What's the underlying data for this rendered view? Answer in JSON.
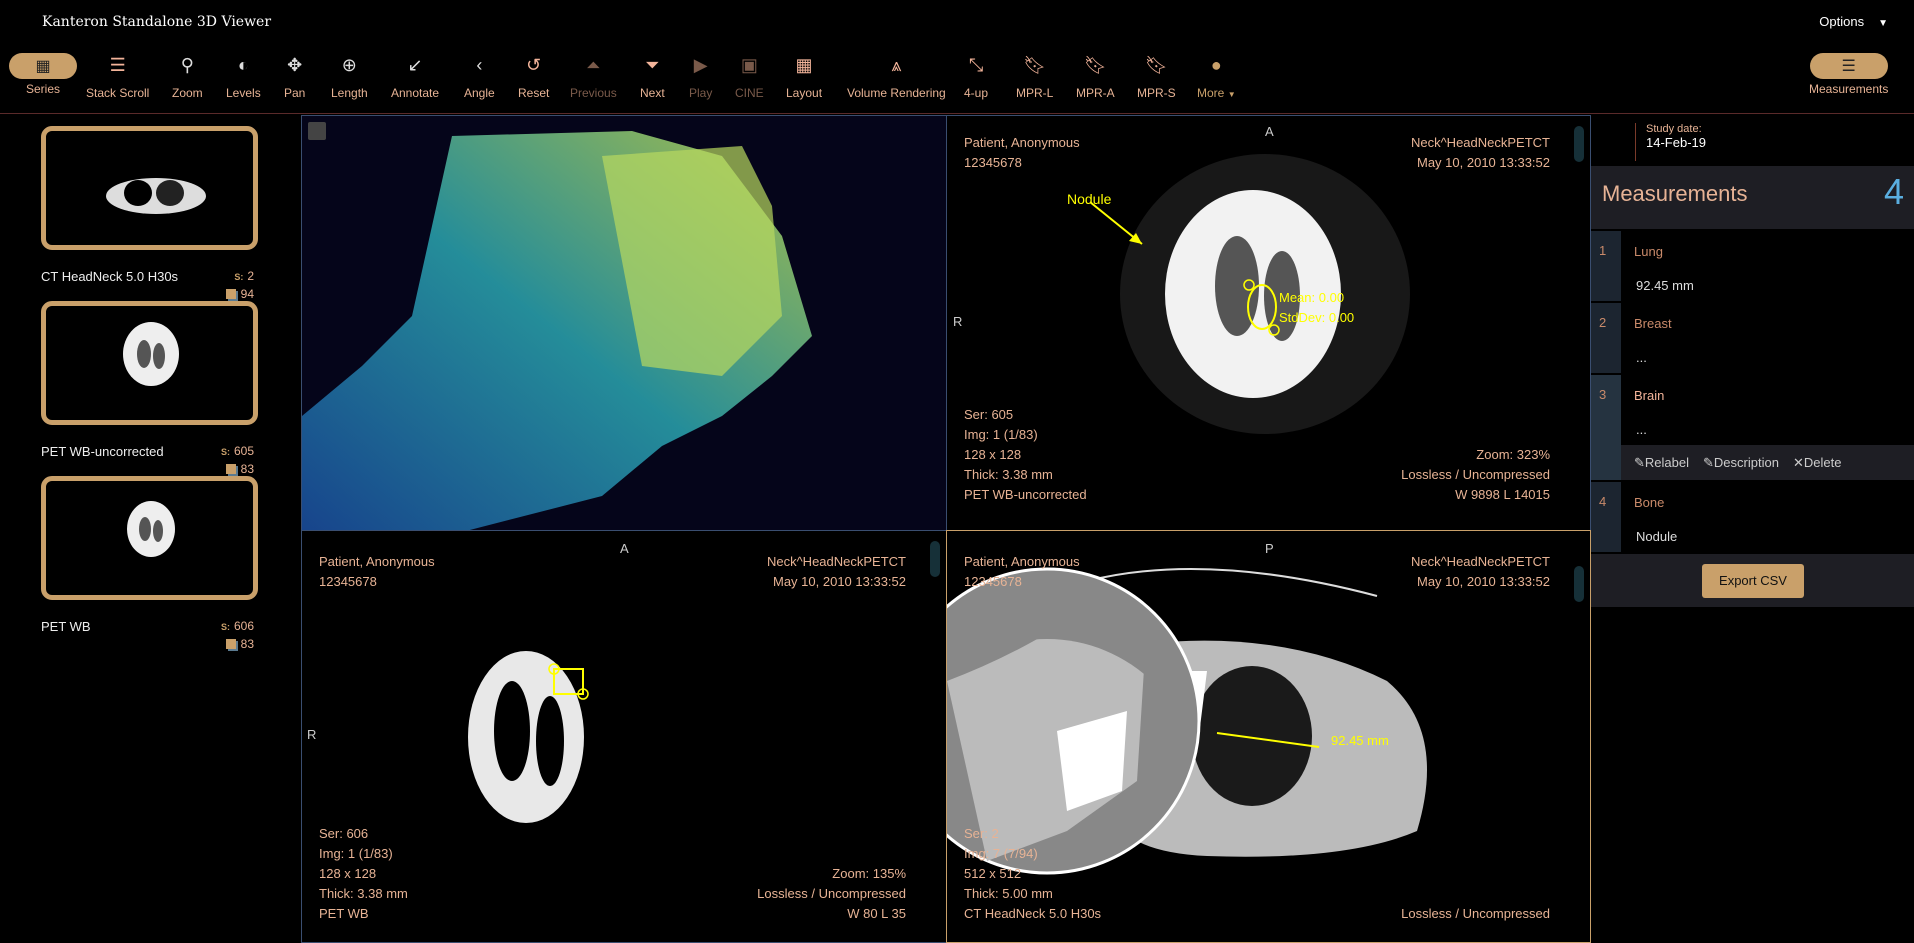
{
  "app": {
    "title": "Kanteron Standalone 3D Viewer",
    "options_label": "Options"
  },
  "toolbar": [
    {
      "label": "Series",
      "icon": "grid-icon"
    },
    {
      "label": "Stack Scroll",
      "icon": "bars-icon"
    },
    {
      "label": "Zoom",
      "icon": "search-icon"
    },
    {
      "label": "Levels",
      "icon": "contrast-icon"
    },
    {
      "label": "Pan",
      "icon": "move-icon"
    },
    {
      "label": "Length",
      "icon": "ruler-icon"
    },
    {
      "label": "Annotate",
      "icon": "arrow-icon"
    },
    {
      "label": "Angle",
      "icon": "angle-icon"
    },
    {
      "label": "Reset",
      "icon": "undo-icon"
    },
    {
      "label": "Previous",
      "icon": "previous-icon"
    },
    {
      "label": "Next",
      "icon": "next-icon"
    },
    {
      "label": "Play",
      "icon": "play-icon"
    },
    {
      "label": "CINE",
      "icon": "youtube-icon"
    },
    {
      "label": "Layout",
      "icon": "layout-icon"
    },
    {
      "label": "Volume Rendering",
      "icon": "road-icon"
    },
    {
      "label": "4-up",
      "icon": "compress-icon"
    },
    {
      "label": "MPR-L",
      "icon": "bookmark-icon"
    },
    {
      "label": "MPR-A",
      "icon": "bookmark-icon"
    },
    {
      "label": "MPR-S",
      "icon": "bookmark-icon"
    },
    {
      "label": "More",
      "icon": "circle-icon"
    }
  ],
  "measurements_button": "Measurements",
  "series": [
    {
      "name": "CT HeadNeck 5.0 H30s",
      "series_num": "2",
      "count": "94"
    },
    {
      "name": "PET WB-uncorrected",
      "series_num": "605",
      "count": "83"
    },
    {
      "name": "PET WB",
      "series_num": "606",
      "count": "83"
    }
  ],
  "series_prefix": "S:",
  "viewports": {
    "top_right": {
      "orient_top": "A",
      "orient_left": "R",
      "patient": "Patient, Anonymous",
      "id": "12345678",
      "study": "Neck^HeadNeckPETCT",
      "date": "May 10, 2010 13:33:52",
      "ser": "Ser: 605",
      "img": "Img: 1 (1/83)",
      "size": "128 x 128",
      "thick": "Thick: 3.38 mm",
      "desc": "PET WB-uncorrected",
      "zoom": "Zoom: 323%",
      "compression": "Lossless / Uncompressed",
      "wl": "W 9898 L 14015",
      "arrow_label": "Nodule",
      "mean": "Mean: 0.00",
      "stddev": "StdDev: 0.00"
    },
    "bottom_left": {
      "orient_top": "A",
      "orient_left": "R",
      "patient": "Patient, Anonymous",
      "id": "12345678",
      "study": "Neck^HeadNeckPETCT",
      "date": "May 10, 2010 13:33:52",
      "ser": "Ser: 606",
      "img": "Img: 1 (1/83)",
      "size": "128 x 128",
      "thick": "Thick: 3.38 mm",
      "desc": "PET WB",
      "zoom": "Zoom: 135%",
      "compression": "Lossless / Uncompressed",
      "wl": "W 80 L 35"
    },
    "bottom_right": {
      "orient_top": "P",
      "patient": "Patient, Anonymous",
      "id": "12345678",
      "study": "Neck^HeadNeckPETCT",
      "date": "May 10, 2010 13:33:52",
      "ser": "Ser: 2",
      "img": "Img: 7 (7/94)",
      "size": "512 x 512",
      "thick": "Thick: 5.00 mm",
      "desc": "CT HeadNeck 5.0 H30s",
      "compression": "Lossless / Uncompressed",
      "length": "92.45 mm"
    }
  },
  "panel": {
    "study_date_label": "Study date:",
    "study_date": "14-Feb-19",
    "title": "Measurements",
    "count": "4",
    "items": [
      {
        "num": "1",
        "label": "Lung",
        "value": "92.45 mm"
      },
      {
        "num": "2",
        "label": "Breast",
        "value": "..."
      },
      {
        "num": "3",
        "label": "Brain",
        "value": "..."
      },
      {
        "num": "4",
        "label": "Bone",
        "value": "Nodule"
      }
    ],
    "actions": {
      "relabel": "Relabel",
      "description": "Description",
      "delete": "Delete"
    },
    "export": "Export CSV"
  },
  "colors": {
    "accent": "#c9a06a",
    "text": "#e7b395",
    "annotation": "#ffff00",
    "count": "#5aaee0"
  }
}
